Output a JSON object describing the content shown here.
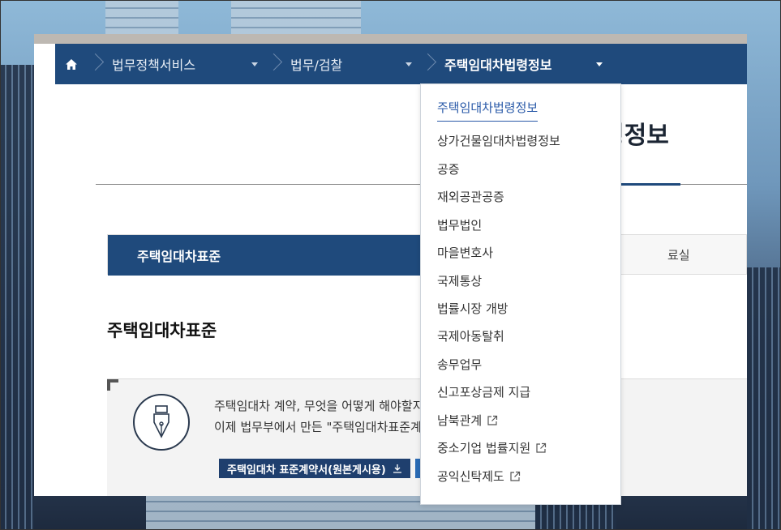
{
  "navbar": {
    "home_icon": "home-icon",
    "items": [
      {
        "label": "법무정책서비스"
      },
      {
        "label": "법무/검찰"
      },
      {
        "label": "주택임대차법령정보"
      }
    ]
  },
  "page": {
    "title_fragment": "령정보",
    "tabs": {
      "active": "주택임대차표준",
      "other_fragment": "료실"
    },
    "section_title": "주택임대차표준",
    "info": {
      "line1": "주택임대차 계약, 무엇을 어떻게 해야할지",
      "line2": "이제 법무부에서 만든 \"주택임대차표준계",
      "download_label": "주택임대차 표준계약서(원본게시용)"
    }
  },
  "dropdown": {
    "items": [
      {
        "label": "주택임대차법령정보",
        "external": false,
        "selected": true
      },
      {
        "label": "상가건물임대차법령정보",
        "external": false
      },
      {
        "label": "공증",
        "external": false
      },
      {
        "label": "재외공관공증",
        "external": false
      },
      {
        "label": "법무법인",
        "external": false
      },
      {
        "label": "마을변호사",
        "external": false
      },
      {
        "label": "국제통상",
        "external": false
      },
      {
        "label": "법률시장 개방",
        "external": false
      },
      {
        "label": "국제아동탈취",
        "external": false
      },
      {
        "label": "송무업무",
        "external": false
      },
      {
        "label": "신고포상금제 지급",
        "external": false
      },
      {
        "label": "남북관계",
        "external": true
      },
      {
        "label": "중소기업 법률지원",
        "external": true
      },
      {
        "label": "공익신탁제도",
        "external": true
      }
    ]
  },
  "colors": {
    "nav": "#1f4a7c",
    "accent": "#2a5aa8"
  }
}
